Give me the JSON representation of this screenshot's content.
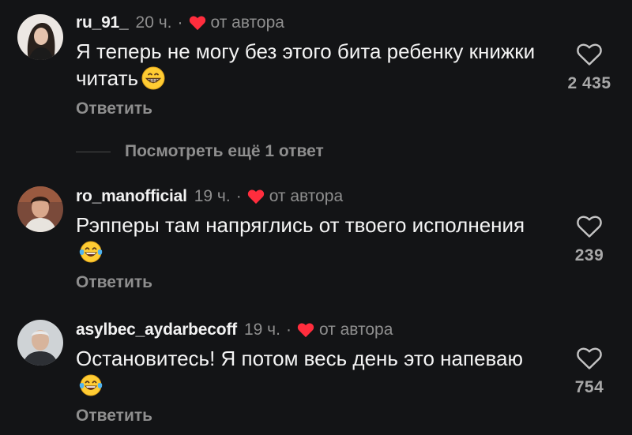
{
  "comments": [
    {
      "username": "ru_91_",
      "time": "20 ч.",
      "separator": "·",
      "author_label": "от автора",
      "text": "Я теперь не могу без этого бита ребенку книжки читать",
      "emoji": "grinning-face-emoji",
      "reply": "Ответить",
      "likes": "2 435"
    },
    {
      "username": "ro_manofficial",
      "time": "19 ч.",
      "separator": "·",
      "author_label": "от автора",
      "text": "Рэпперы там напряглись от твоего исполнения",
      "emoji": "tears-of-joy-emoji",
      "reply": "Ответить",
      "likes": "239"
    },
    {
      "username": "asylbec_aydarbecoff",
      "time": "19 ч.",
      "separator": "·",
      "author_label": "от автора",
      "text": "Остановитесь! Я потом весь день это напеваю",
      "emoji": "tears-of-joy-emoji",
      "reply": "Ответить",
      "likes": "754"
    }
  ],
  "view_more_replies": "Посмотреть ещё 1 ответ",
  "colors": {
    "background": "#131416",
    "author_heart": "#ff2d3d",
    "muted": "#8e8e8e"
  }
}
